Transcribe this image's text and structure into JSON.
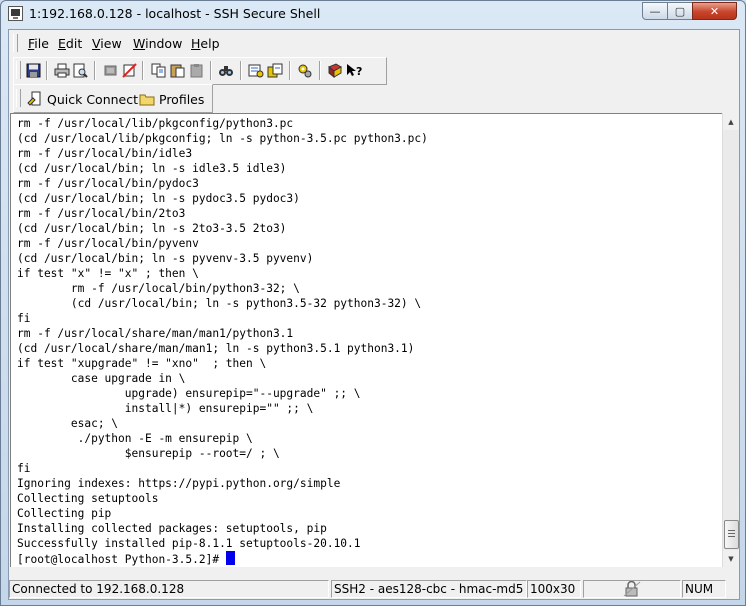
{
  "window": {
    "title": "1:192.168.0.128 - localhost - SSH Secure Shell",
    "controls": {
      "minimize": "—",
      "maximize": "▢",
      "close": "✕"
    }
  },
  "menu": [
    "File",
    "Edit",
    "View",
    "Window",
    "Help"
  ],
  "toolbar": {
    "buttons": [
      "save-icon",
      "print-icon",
      "print-preview-icon",
      "disconnect-icon",
      "clear-terminal-icon",
      "copy-icon",
      "paste-icon",
      "paste-alt-icon",
      "find-icon",
      "settings-icon",
      "file-transfer-icon",
      "preferences-icon",
      "help-book-icon",
      "context-help-icon"
    ]
  },
  "quickbar": {
    "quick_connect": "Quick Connect",
    "profiles": "Profiles"
  },
  "terminal": {
    "lines": [
      "rm -f /usr/local/lib/pkgconfig/python3.pc",
      "(cd /usr/local/lib/pkgconfig; ln -s python-3.5.pc python3.pc)",
      "rm -f /usr/local/bin/idle3",
      "(cd /usr/local/bin; ln -s idle3.5 idle3)",
      "rm -f /usr/local/bin/pydoc3",
      "(cd /usr/local/bin; ln -s pydoc3.5 pydoc3)",
      "rm -f /usr/local/bin/2to3",
      "(cd /usr/local/bin; ln -s 2to3-3.5 2to3)",
      "rm -f /usr/local/bin/pyvenv",
      "(cd /usr/local/bin; ln -s pyvenv-3.5 pyvenv)",
      "if test \"x\" != \"x\" ; then \\",
      "        rm -f /usr/local/bin/python3-32; \\",
      "        (cd /usr/local/bin; ln -s python3.5-32 python3-32) \\",
      "fi",
      "rm -f /usr/local/share/man/man1/python3.1",
      "(cd /usr/local/share/man/man1; ln -s python3.5.1 python3.1)",
      "if test \"xupgrade\" != \"xno\"  ; then \\",
      "        case upgrade in \\",
      "                upgrade) ensurepip=\"--upgrade\" ;; \\",
      "                install|*) ensurepip=\"\" ;; \\",
      "        esac; \\",
      "         ./python -E -m ensurepip \\",
      "                $ensurepip --root=/ ; \\",
      "fi",
      "Ignoring indexes: https://pypi.python.org/simple",
      "Collecting setuptools",
      "Collecting pip",
      "Installing collected packages: setuptools, pip",
      "Successfully installed pip-8.1.1 setuptools-20.10.1"
    ],
    "prompt": "[root@localhost Python-3.5.2]# "
  },
  "status": {
    "connection": "Connected to 192.168.0.128",
    "cipher": "SSH2 - aes128-cbc - hmac-md5",
    "size": "100x30",
    "numlock": "NUM"
  }
}
